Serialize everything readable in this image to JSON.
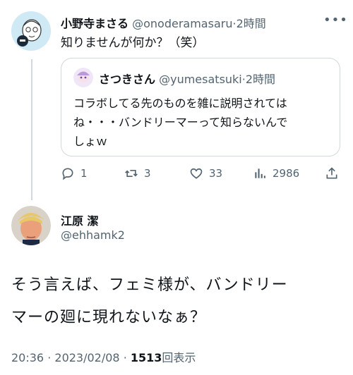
{
  "main_tweet": {
    "display_name": "小野寺まさる",
    "handle": "@onoderamasaru",
    "separator": "·",
    "time": "2時間",
    "text": "知りませんが何か？（笑）"
  },
  "quoted_tweet": {
    "display_name": "さつきさん",
    "handle": "@yumesatsuki",
    "separator": "·",
    "time": "2時間",
    "text_line1": "コラボしてる先のものを雑に説明されては",
    "text_line2": "ね・・・バンドリーマーって知らないんで",
    "text_line3": "しょｗ"
  },
  "actions": {
    "replies": "1",
    "retweets": "3",
    "likes": "33",
    "views": "2986"
  },
  "reply_tweet": {
    "display_name": "江原 潔",
    "handle": "@ehhamk2",
    "text_line1": "そう言えば、フェミ様が、バンドリー",
    "text_line2": "マーの廻に現れないなぁ？"
  },
  "footer": {
    "time": "20:36",
    "date": "2023/02/08",
    "separator": "·",
    "views_count": "1513",
    "views_label": "回表示"
  },
  "icons": {
    "reply": "reply-icon",
    "retweet": "retweet-icon",
    "like": "heart-icon",
    "views": "analytics-icon",
    "share": "share-icon",
    "more": "more-icon"
  }
}
